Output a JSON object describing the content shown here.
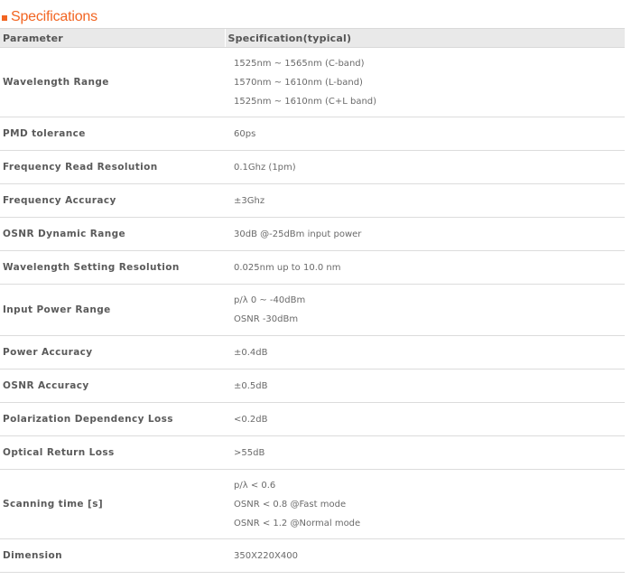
{
  "section": {
    "title": "Specifications"
  },
  "table": {
    "headers": [
      "Parameter",
      "Specification(typical)"
    ],
    "rows": [
      {
        "param": "Wavelength Range",
        "lines": [
          "1525nm ~ 1565nm (C-band)",
          "1570nm ~ 1610nm (L-band)",
          "1525nm ~ 1610nm (C+L band)"
        ]
      },
      {
        "param": "PMD tolerance",
        "lines": [
          "60ps"
        ]
      },
      {
        "param": "Frequency Read Resolution",
        "lines": [
          "0.1Ghz (1pm)"
        ]
      },
      {
        "param": "Frequency Accuracy",
        "lines": [
          "±3Ghz"
        ]
      },
      {
        "param": "OSNR Dynamic Range",
        "lines": [
          "30dB @-25dBm input power"
        ]
      },
      {
        "param": "Wavelength Setting Resolution",
        "lines": [
          "0.025nm up to 10.0 nm"
        ]
      },
      {
        "param": "Input Power Range",
        "lines": [
          "p/λ 0 ~ -40dBm",
          "OSNR -30dBm"
        ]
      },
      {
        "param": "Power Accuracy",
        "lines": [
          "±0.4dB"
        ]
      },
      {
        "param": "OSNR Accuracy",
        "lines": [
          "±0.5dB"
        ]
      },
      {
        "param": "Polarization Dependency Loss",
        "lines": [
          "<0.2dB"
        ]
      },
      {
        "param": "Optical Return Loss",
        "lines": [
          ">55dB"
        ]
      },
      {
        "param": "Scanning time [s]",
        "lines": [
          "p/λ < 0.6",
          "OSNR < 0.8 @Fast mode",
          "OSNR < 1.2 @Normal mode"
        ]
      },
      {
        "param": "Dimension",
        "lines": [
          "350X220X400"
        ]
      }
    ]
  },
  "colors": {
    "accent": "#f26522",
    "header_bg": "#e9e9e9",
    "border": "#dcdcdc"
  }
}
